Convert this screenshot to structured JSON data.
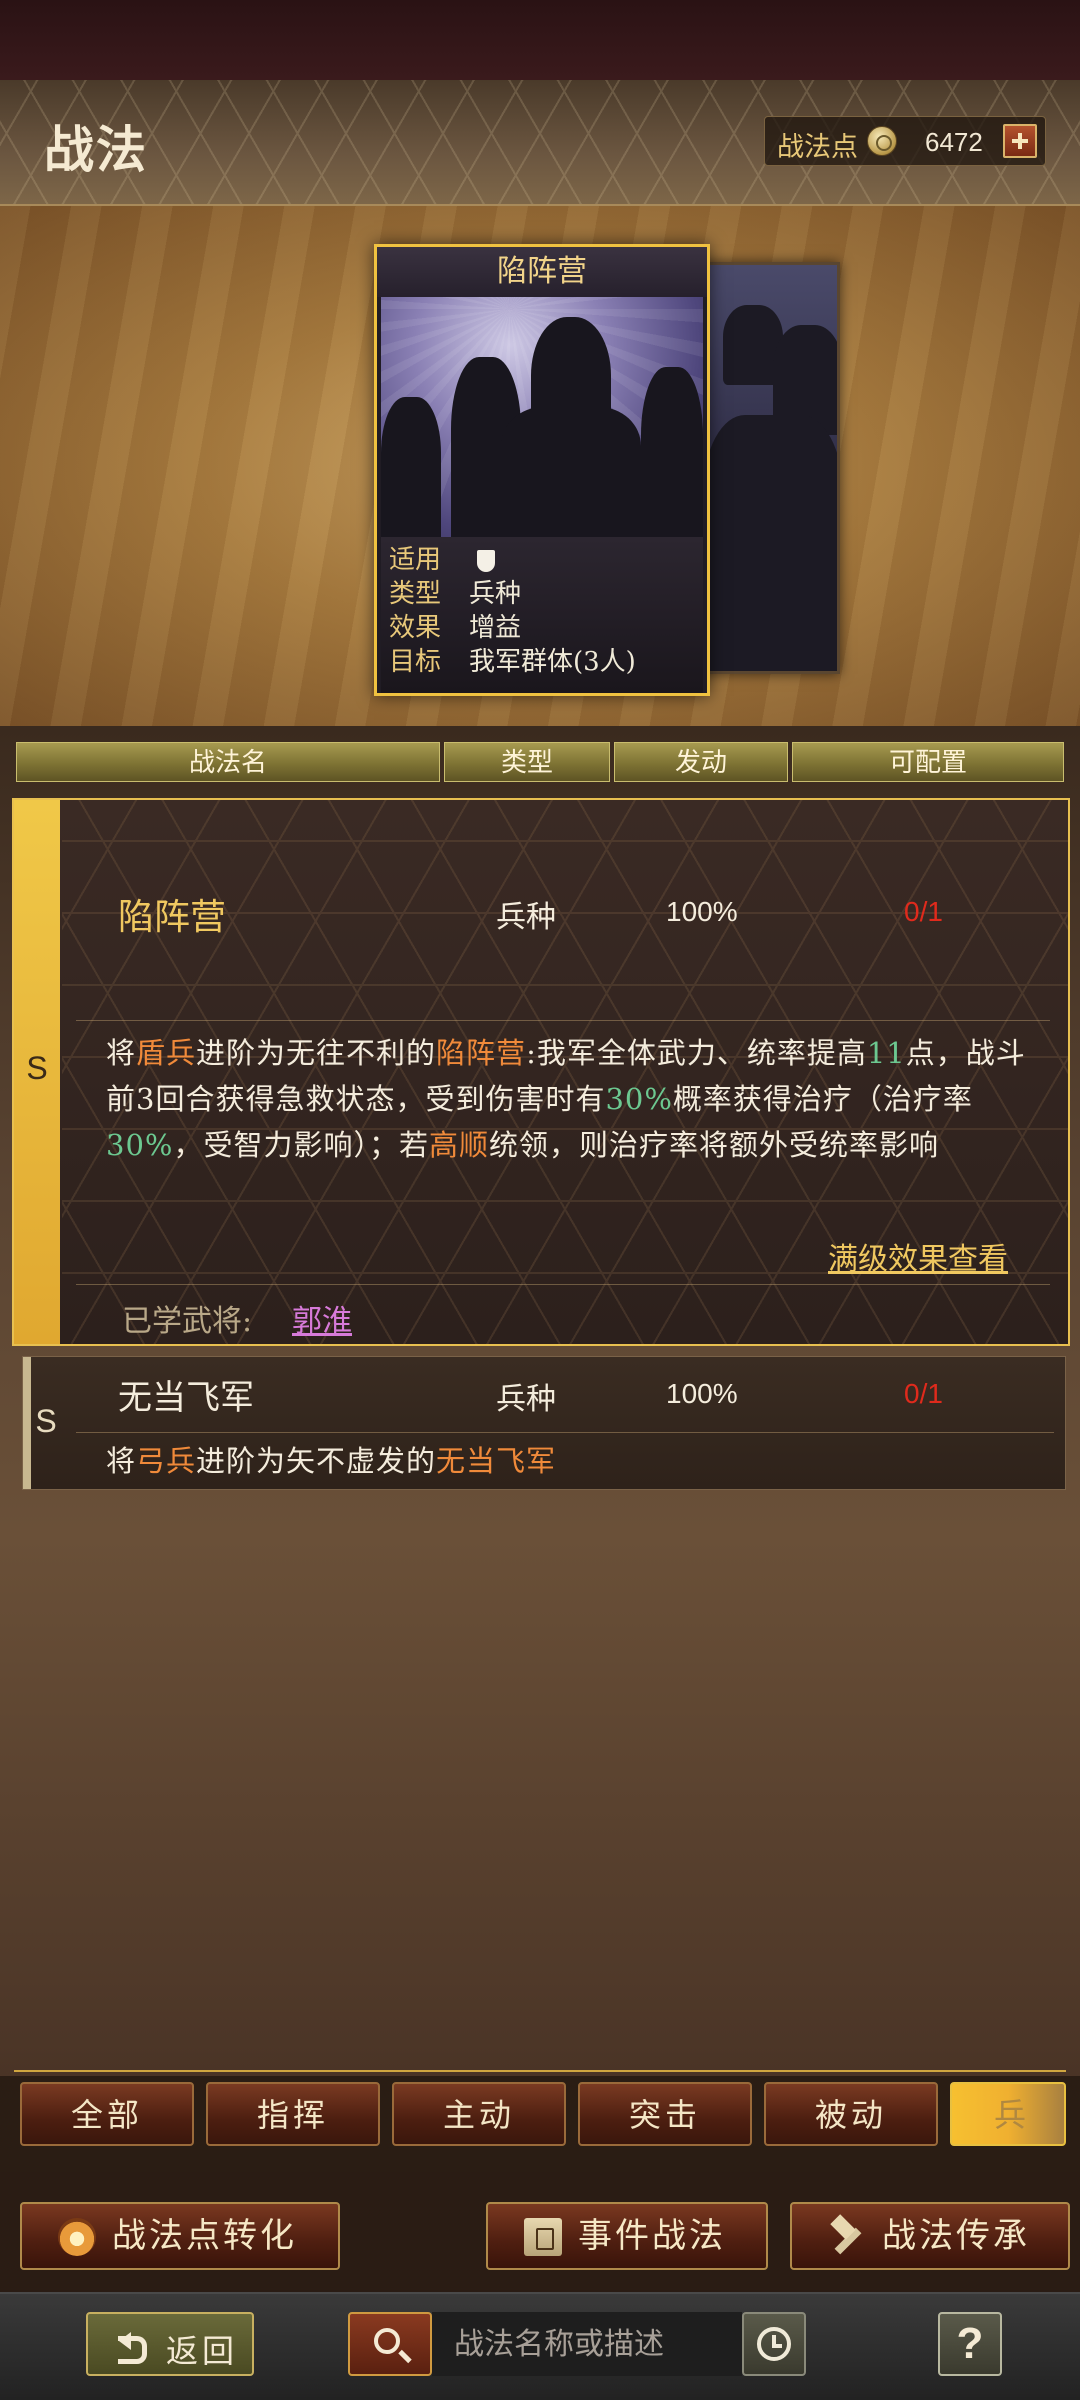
{
  "header": {
    "title": "战法",
    "points_label": "战法点",
    "points_value": "6472"
  },
  "card": {
    "title": "陷阵营",
    "rows": [
      {
        "key": "适用",
        "value": ""
      },
      {
        "key": "类型",
        "value": "兵种"
      },
      {
        "key": "效果",
        "value": "增益"
      },
      {
        "key": "目标",
        "value": "我军群体(3人)"
      }
    ]
  },
  "table": {
    "columns": [
      "战法名",
      "类型",
      "发动",
      "可配置"
    ]
  },
  "skills": [
    {
      "grade": "S",
      "name": "陷阵营",
      "type": "兵种",
      "rate": "100%",
      "config": "0/1",
      "desc": [
        {
          "t": "将",
          "c": ""
        },
        {
          "t": "盾兵",
          "c": "o"
        },
        {
          "t": "进阶为无往不利的",
          "c": ""
        },
        {
          "t": "陷阵营",
          "c": "o"
        },
        {
          "t": ":我军全体武力、统率提高",
          "c": ""
        },
        {
          "t": "11",
          "c": "g"
        },
        {
          "t": "点，战斗前3回合获得急救状态，受到伤害时有",
          "c": ""
        },
        {
          "t": "30%",
          "c": "g"
        },
        {
          "t": "概率获得治疗（治疗率",
          "c": ""
        },
        {
          "t": "30%",
          "c": "g"
        },
        {
          "t": "，受智力影响）；若",
          "c": ""
        },
        {
          "t": "高顺",
          "c": "o"
        },
        {
          "t": "统领，则治疗率将额外受统率影响",
          "c": ""
        }
      ],
      "maxlevel_link": "满级效果查看",
      "learned_label": "已学武将:",
      "learned_name": "郭淮"
    },
    {
      "grade": "S",
      "name": "无当飞军",
      "type": "兵种",
      "rate": "100%",
      "config": "0/1",
      "desc": [
        {
          "t": "将",
          "c": ""
        },
        {
          "t": "弓兵",
          "c": "o"
        },
        {
          "t": "进阶为矢不虚发的",
          "c": ""
        },
        {
          "t": "无当飞军",
          "c": "o"
        }
      ]
    }
  ],
  "filter_tabs": [
    "全部",
    "指挥",
    "主动",
    "突击",
    "被动",
    "兵"
  ],
  "actions": {
    "convert": "战法点转化",
    "event": "事件战法",
    "inherit": "战法传承"
  },
  "bottom": {
    "back": "返回",
    "search_placeholder": "战法名称或描述",
    "help": "?"
  }
}
